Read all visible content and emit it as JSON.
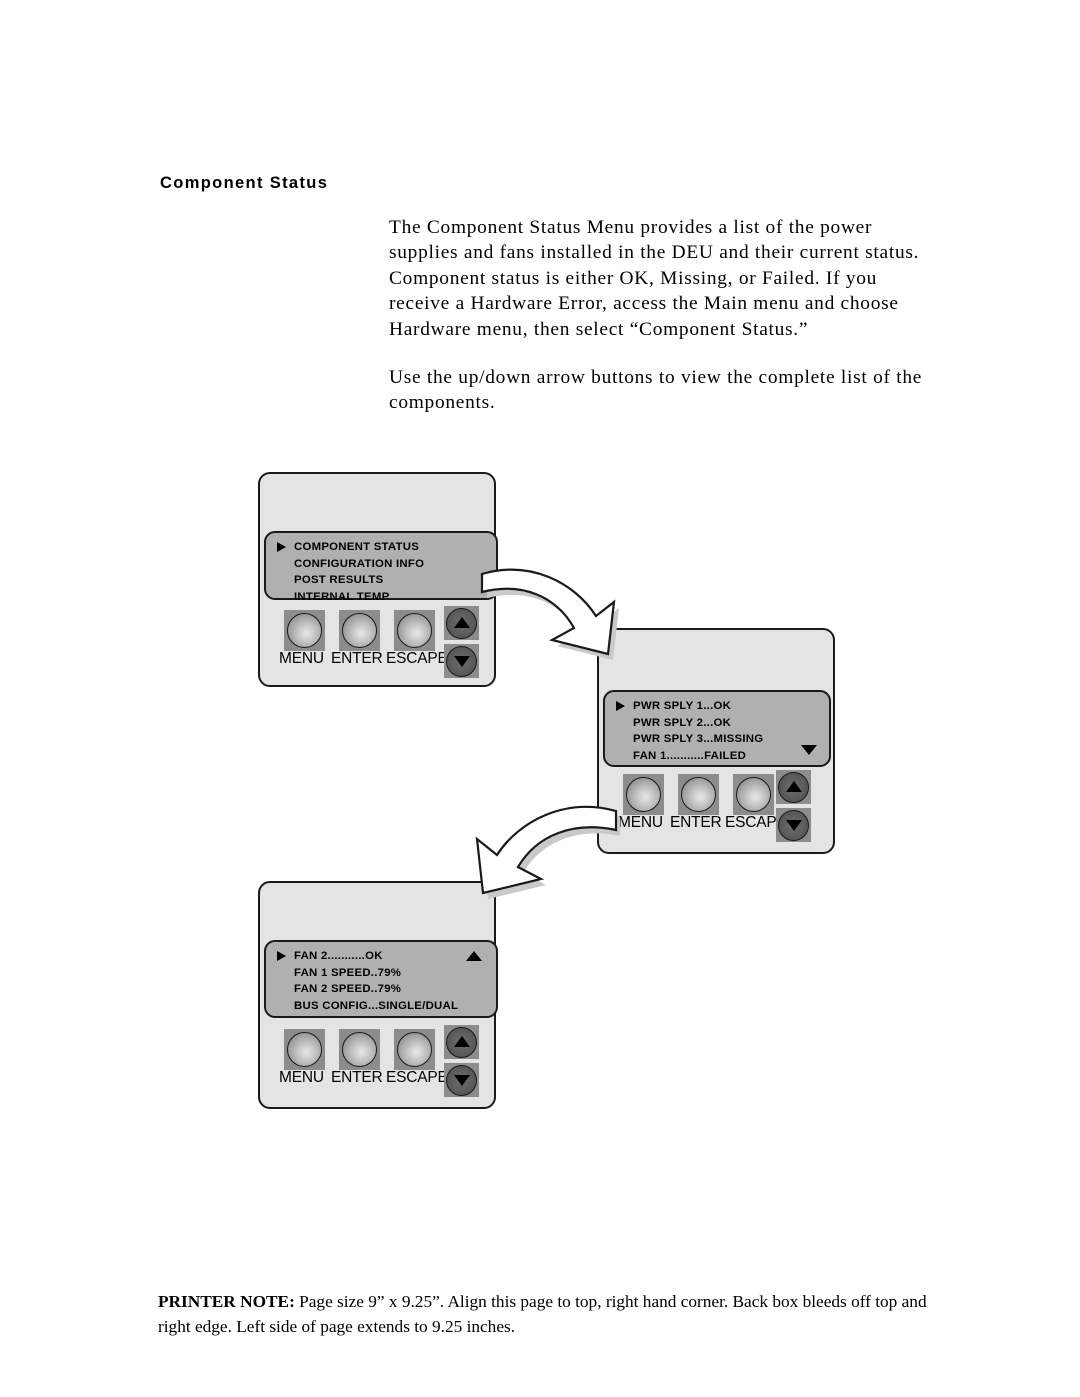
{
  "page": {
    "heading": "Component Status",
    "paragraphs": [
      "The Component Status Menu provides a list of the power supplies and fans installed in the DEU and their current status. Component status is either OK, Missing, or Failed. If you receive a Hardware Error, access the Main menu and choose Hardware menu, then select “Component Status.”",
      "Use the up/down arrow buttons to view the complete list of the components."
    ]
  },
  "colors": {
    "page_background": "#ffffff",
    "panel_face": "#e4e4e4",
    "lcd_screen": "#b0b0b0",
    "button_pad": "#8c8c8c",
    "outline": "#1a1a1a",
    "text": "#000000"
  },
  "devices": [
    {
      "id": "device-1",
      "name": "deu-front-panel-menu",
      "lcd": {
        "rows": [
          {
            "text": "COMPONENT STATUS",
            "cursor": true
          },
          {
            "text": "CONFIGURATION INFO",
            "cursor": false
          },
          {
            "text": "POST RESULTS",
            "cursor": false
          },
          {
            "text": "INTERNAL TEMP",
            "cursor": false
          }
        ],
        "scroll_indicator": "none"
      },
      "buttons": [
        {
          "label": "MENU",
          "icon": "round-push-button"
        },
        {
          "label": "ENTER",
          "icon": "round-push-button"
        },
        {
          "label": "ESCAPE",
          "icon": "round-push-button"
        }
      ],
      "arrow_buttons": [
        {
          "icon": "triangle-up-icon",
          "direction": "up"
        },
        {
          "icon": "triangle-down-icon",
          "direction": "down"
        }
      ]
    },
    {
      "id": "device-2",
      "name": "deu-front-panel-component-status-page-1",
      "lcd": {
        "rows": [
          {
            "text": "PWR SPLY 1...OK",
            "cursor": true
          },
          {
            "text": "PWR SPLY 2...OK",
            "cursor": false
          },
          {
            "text": "PWR SPLY 3...MISSING",
            "cursor": false
          },
          {
            "text": "FAN 1...........FAILED",
            "cursor": false
          }
        ],
        "scroll_indicator": "down"
      },
      "buttons": [
        {
          "label": "MENU",
          "icon": "round-push-button"
        },
        {
          "label": "ENTER",
          "icon": "round-push-button"
        },
        {
          "label": "ESCAPE",
          "icon": "round-push-button"
        }
      ],
      "arrow_buttons": [
        {
          "icon": "triangle-up-icon",
          "direction": "up"
        },
        {
          "icon": "triangle-down-icon",
          "direction": "down"
        }
      ]
    },
    {
      "id": "device-3",
      "name": "deu-front-panel-component-status-page-2",
      "lcd": {
        "rows": [
          {
            "text": "FAN 2...........OK",
            "cursor": true
          },
          {
            "text": "FAN 1 SPEED..79%",
            "cursor": false
          },
          {
            "text": "FAN 2 SPEED..79%",
            "cursor": false
          },
          {
            "text": "BUS CONFIG...SINGLE/DUAL",
            "cursor": false
          }
        ],
        "scroll_indicator": "up"
      },
      "buttons": [
        {
          "label": "MENU",
          "icon": "round-push-button"
        },
        {
          "label": "ENTER",
          "icon": "round-push-button"
        },
        {
          "label": "ESCAPE",
          "icon": "round-push-button"
        }
      ],
      "arrow_buttons": [
        {
          "icon": "triangle-up-icon",
          "direction": "up"
        },
        {
          "icon": "triangle-down-icon",
          "direction": "down"
        }
      ]
    }
  ],
  "connectors": [
    {
      "icon": "curved-arrow-down-right-icon",
      "from": "device-1",
      "to": "device-2"
    },
    {
      "icon": "curved-arrow-down-left-icon",
      "from": "device-2",
      "to": "device-3"
    }
  ],
  "footer": {
    "label": "PRINTER NOTE:",
    "text": " Page size 9” x 9.25”.  Align this page to top, right hand corner. Back box bleeds off top and right edge. Left side of page extends to 9.25 inches."
  }
}
